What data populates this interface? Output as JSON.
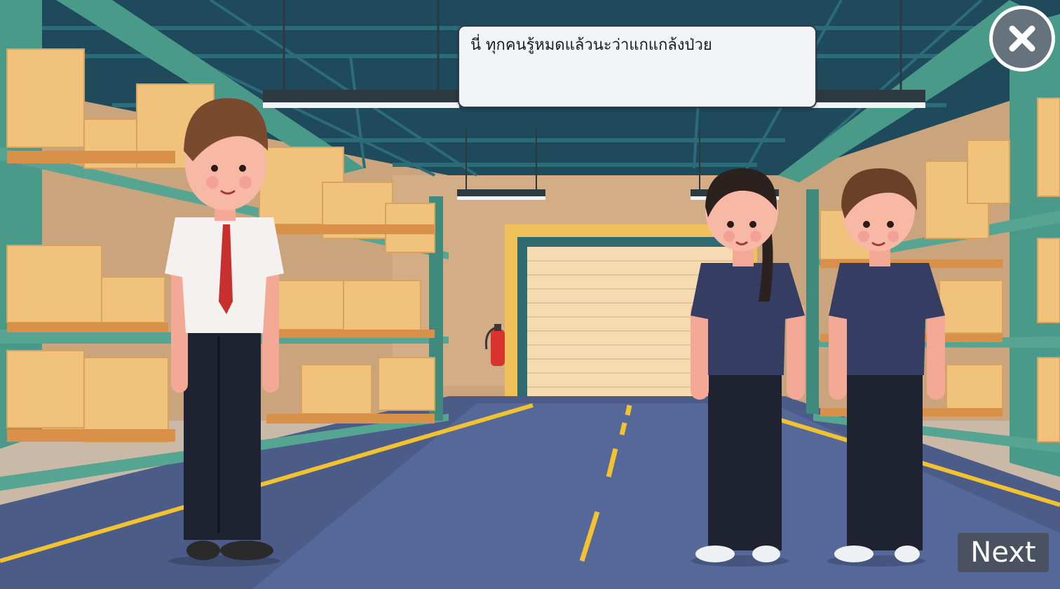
{
  "dialog": {
    "text": "นี่ ทุกคนรู้หมดแล้วนะว่าแกแกล้งป่วย"
  },
  "controls": {
    "close_icon": "close-icon",
    "next_label": "Next"
  },
  "scene": {
    "setting": "warehouse",
    "characters": [
      "boy-in-uniform-with-tie",
      "girl-in-worker-uniform",
      "boy-in-worker-uniform"
    ],
    "colors": {
      "wall": "#cfa982",
      "floor": "#4a5b86",
      "shelf": "#55a592",
      "box": "#f1c27b",
      "door": "#f6dcb3",
      "ceiling": "#1f4b5c",
      "worker_shirt": "#353d62",
      "pants": "#1f2230"
    }
  }
}
